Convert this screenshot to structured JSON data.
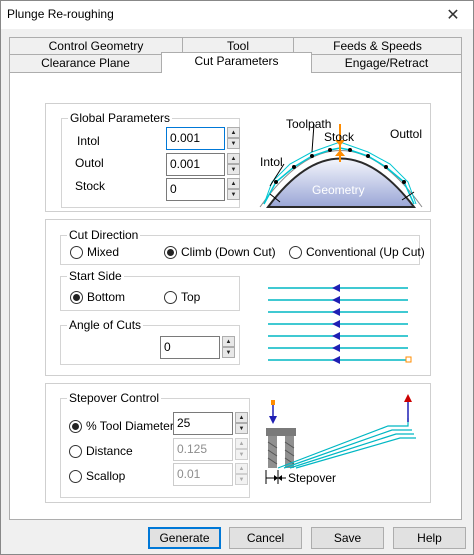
{
  "window": {
    "title": "Plunge Re-roughing",
    "close_glyph": "✕"
  },
  "tabs": {
    "row1": [
      "Control Geometry",
      "Tool",
      "Feeds & Speeds"
    ],
    "row2": [
      "Clearance Plane",
      "Cut Parameters",
      "Engage/Retract"
    ],
    "active": "Cut Parameters"
  },
  "global_parameters": {
    "title": "Global Parameters",
    "intol_label": "Intol",
    "intol_value": "0.001",
    "outol_label": "Outol",
    "outol_value": "0.001",
    "stock_label": "Stock",
    "stock_value": "0",
    "diagram": {
      "toolpath": "Toolpath",
      "stock": "Stock",
      "outtol": "Outtol",
      "intol": "Intol",
      "geometry": "Geometry"
    }
  },
  "cut_direction": {
    "title": "Cut Direction",
    "options": [
      "Mixed",
      "Climb (Down Cut)",
      "Conventional (Up Cut)"
    ],
    "selected": "Climb (Down Cut)"
  },
  "start_side": {
    "title": "Start Side",
    "options": [
      "Bottom",
      "Top"
    ],
    "selected": "Bottom"
  },
  "angle_of_cuts": {
    "title": "Angle of Cuts",
    "value": "0"
  },
  "stepover_control": {
    "title": "Stepover Control",
    "options": [
      "% Tool Diameter",
      "Distance",
      "Scallop"
    ],
    "selected": "% Tool Diameter",
    "tool_diameter_value": "25",
    "distance_value": "0.125",
    "scallop_value": "0.01",
    "diagram_label": "Stepover"
  },
  "buttons": {
    "generate": "Generate",
    "cancel": "Cancel",
    "save": "Save",
    "help": "Help"
  },
  "colors": {
    "accent": "#0078d7",
    "path": "#00b7c3",
    "arrow": "#1f1fb4",
    "stock_marker": "#ff8c00",
    "tool_marker": "#cc0000"
  }
}
